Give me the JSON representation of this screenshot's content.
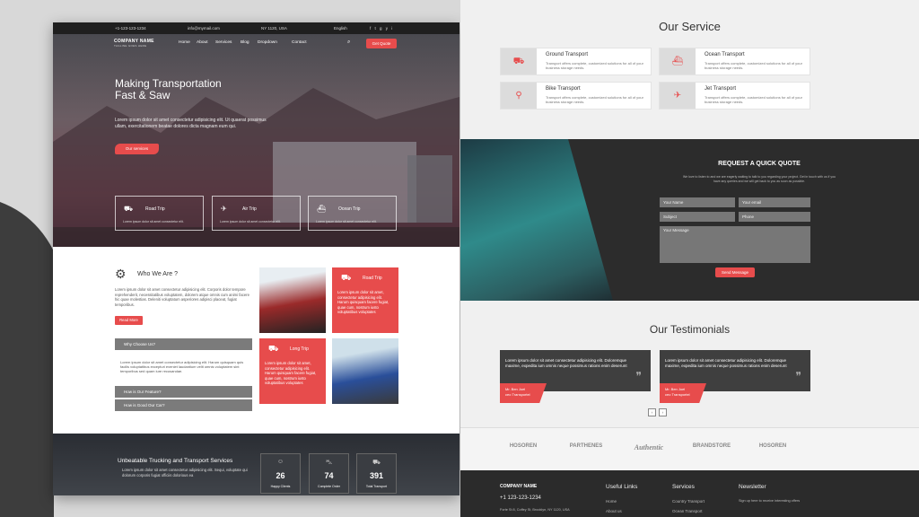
{
  "left_page": {
    "topbar": {
      "phone": "+1-123-123-1234",
      "email": "info@mymail.com",
      "address": "NY 1120, USA",
      "language": "English"
    },
    "nav": {
      "logo": "COMPANY NAME",
      "logo_sub": "TAGLINE GOES HERE",
      "links": [
        "Home",
        "About",
        "Services",
        "Blog",
        "Dropdown",
        "Contact"
      ],
      "cta": "Get Quote"
    },
    "hero": {
      "title": "Making Transportation Fast & Saw",
      "text": "Lorem ipsum dolor sit amet consectetur adipisicing elit. Ut quaerat possimus ullam, exercitationem beatae dolores dicta magnam eum qui.",
      "button": "Our services",
      "features": [
        {
          "icon": "truck-icon",
          "title": "Road Trip",
          "desc": "Lorem ipsum dolor sit amet consectetur elit."
        },
        {
          "icon": "plane-icon",
          "title": "Air Trip",
          "desc": "Lorem ipsum dolor sit amet consectetur elit."
        },
        {
          "icon": "ship-icon",
          "title": "Ocean Trip",
          "desc": "Lorem ipsum dolor sit amet consectetur elit."
        }
      ]
    },
    "who": {
      "title": "Who We Are ?",
      "text": "Lorem ipsum dolor sit amet consectetur adipisicing elit. Corporis dolor tempore reprehenderit, necessitatibus voluptatem, dolorem atque omnis cum animi facere hic quae molestias. Deleniti voluptatum asperiores adipisci placeat, fugiat temporibus.",
      "button": "Read More",
      "accordion": [
        "Why Choose Us?",
        "How is Our Feature?",
        "How is Good Our Car?"
      ],
      "accordion_text": "Lorem ipsum dolor sit amet consectetur adipisicing elit. Harum quisquam quis facilis voluptatibus excepturi eveniet laudantium velit omnis voluptatem sint temporibus sed quam iure recusandae."
    },
    "cards": [
      {
        "title": "Road Trip",
        "desc": "Lorem ipsum dolor sit amet, consectetur adipisicing elit. Harum quisquam facere fugiat, quae cum, nostrum iusto voluptatibus voluptates"
      },
      {
        "title": "Long Trip",
        "desc": "Lorem ipsum dolor sit amet, consectetur adipisicing elit. Harum quisquam facere fugiat, quae cum, nostrum iusto voluptatibus voluptates"
      }
    ],
    "stats": {
      "title": "Unbeatable Trucking and Transport Services",
      "text": "Lorem ipsum dolor sit amet consectetur adipisicing elit. Sequi, voluptate qui dolorum corporis fugiat officiis dolorious ea",
      "items": [
        {
          "icon": "smile-icon",
          "value": "26",
          "label": "Happy Clients"
        },
        {
          "icon": "cart-icon",
          "value": "74",
          "label": "Complete Order"
        },
        {
          "icon": "truck-icon",
          "value": "391",
          "label": "Total Transport"
        }
      ]
    }
  },
  "right_page": {
    "services_title": "Our Service",
    "services": [
      {
        "icon": "truck-icon",
        "title": "Ground Transport",
        "desc": "Transport offers complete, customized solutions for all of your business storage needs."
      },
      {
        "icon": "ship-icon",
        "title": "Ocean Transport",
        "desc": "Transport offers complete, customized solutions for all of your business storage needs."
      },
      {
        "icon": "bike-icon",
        "title": "Bike Transport",
        "desc": "Transport offers complete, customized solutions for all of your business storage needs."
      },
      {
        "icon": "jet-icon",
        "title": "Jet Transport",
        "desc": "Transport offers complete, customized solutions for all of your business storage needs."
      }
    ],
    "quote": {
      "title": "REQUEST A QUICK QUOTE",
      "desc": "We love to listen to and we are eagerly waiting to talk to you regarding your project. Get in touch with us if you have any queries and we will get back to you as soon as possible.",
      "fields": {
        "name": "Your Name",
        "email": "Your email",
        "subject": "Subject",
        "phone": "Phone",
        "message": "Your Message"
      },
      "button": "Send Message"
    },
    "testimonials_title": "Our Testimonials",
    "testimonials": [
      {
        "quote": "Lorem ipsum dolor sit amet consectetur adipisicing elit. Doloremque maxime, expedita ium omnis neque possimus rations enim deserunt",
        "name": "Mr. Ben Joel",
        "role": "ceo Transportel"
      },
      {
        "quote": "Lorem ipsum dolor sit amet consectetur adipisicing elit. Doloremque maxime, expedita ium omnis neque possimus rations enim deserunt",
        "name": "Mr. Ben Joel",
        "role": "ceo Transportel"
      }
    ],
    "pager": [
      "‹",
      "›"
    ],
    "brands": [
      "HOSOREN",
      "PARTHENES",
      "Authentic",
      "BRANDSTORE",
      "HOSOREN"
    ],
    "footer": {
      "logo": "COMPANY NAME",
      "phone": "+1 123-123-1234",
      "address": "Forte St 8, Coffey St, Brooklyn, NY 1120, USA",
      "cols": [
        {
          "title": "Useful Links",
          "items": [
            "Home",
            "About us"
          ]
        },
        {
          "title": "Services",
          "items": [
            "Country Transport",
            "Ocean Transport"
          ]
        },
        {
          "title": "Newsletter",
          "items": [
            "Sign up here to receive interesting offers"
          ]
        }
      ]
    }
  },
  "colors": {
    "accent": "#e74c4c",
    "dark": "#2c2c2c"
  }
}
